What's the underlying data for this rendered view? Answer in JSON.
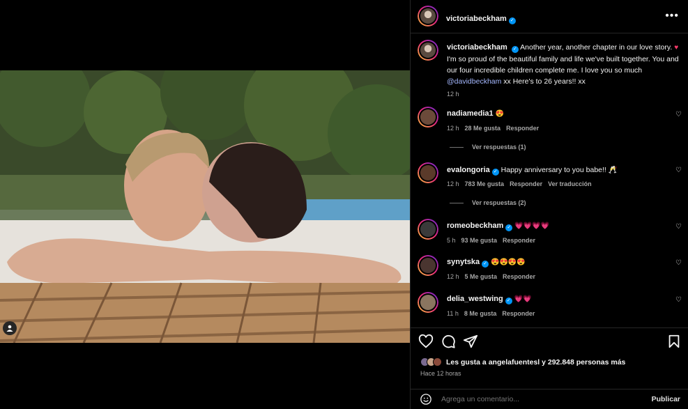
{
  "post": {
    "author": "victoriabeckham",
    "more_icon": "more-horizontal-icon",
    "caption_author": "victoriabeckham",
    "caption_part1": "Another year, another chapter in our love story. ",
    "caption_emoji": "♥",
    "caption_part2": " I'm so proud of the beautiful family and life we've built together. You and our four incredible children complete me. I love you so much ",
    "caption_mention": "@davidbeckham",
    "caption_part3": " xx Here's to 26 years!! xx",
    "caption_time": "12 h"
  },
  "comments": [
    {
      "user": "nadiamedia1",
      "verified": false,
      "text": "😍",
      "time": "12 h",
      "likes": "28 Me gusta",
      "reply": "Responder",
      "translate": "",
      "replies": "Ver respuestas (1)",
      "avatar_color": "#6b4a3a"
    },
    {
      "user": "evalongoria",
      "verified": true,
      "text": "Happy anniversary to you babe!! 🥂",
      "time": "12 h",
      "likes": "783 Me gusta",
      "reply": "Responder",
      "translate": "Ver traducción",
      "replies": "Ver respuestas (2)",
      "avatar_color": "#5a3a2a"
    },
    {
      "user": "romeobeckham",
      "verified": true,
      "text": "💗💗💗💗",
      "time": "5 h",
      "likes": "93 Me gusta",
      "reply": "Responder",
      "translate": "",
      "replies": "",
      "avatar_color": "#3a3a3a"
    },
    {
      "user": "synytska",
      "verified": true,
      "text": "😍😍😍😍",
      "time": "12 h",
      "likes": "5 Me gusta",
      "reply": "Responder",
      "translate": "",
      "replies": "",
      "avatar_color": "#4a3530"
    },
    {
      "user": "delia_westwing",
      "verified": true,
      "text": "💗💗",
      "time": "11 h",
      "likes": "8 Me gusta",
      "reply": "Responder",
      "translate": "",
      "replies": "",
      "avatar_color": "#8a7560"
    }
  ],
  "actions": {
    "like_icon": "heart-icon",
    "comment_icon": "comment-icon",
    "share_icon": "send-icon",
    "save_icon": "bookmark-icon",
    "likes_text": "Les gusta a angelafuentesl y 292.848 personas más",
    "posted_time": "Hace 12 horas"
  },
  "add_comment": {
    "placeholder": "Agrega un comentario...",
    "publish": "Publicar",
    "emoji_icon": "smile-icon"
  },
  "colors": {
    "background": "#000000",
    "verified": "#0095f6",
    "heart_emoji": "#ff3b6b",
    "muted": "#a8a8a8"
  }
}
